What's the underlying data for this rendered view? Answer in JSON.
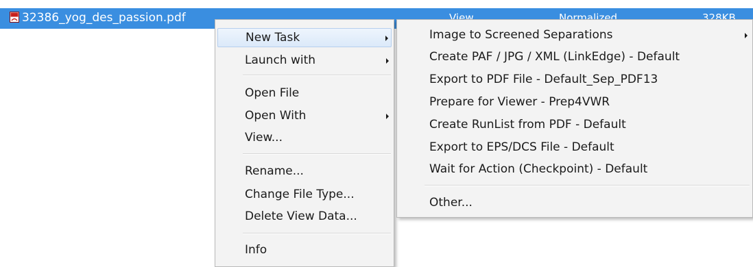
{
  "file_row": {
    "name": "32386_yog_des_passion.pdf",
    "view": "View",
    "status": "Normalized",
    "size": "328KB",
    "icon": "pdf-file-icon",
    "highlight_color": "#3a8ee0"
  },
  "context_menu": {
    "items": [
      {
        "label": "New Task"
      },
      {
        "label": "Launch with"
      },
      {
        "label": "Open File"
      },
      {
        "label": "Open With"
      },
      {
        "label": "View..."
      },
      {
        "label": "Rename..."
      },
      {
        "label": "Change File Type..."
      },
      {
        "label": "Delete View Data..."
      },
      {
        "label": "Info"
      }
    ]
  },
  "submenu": {
    "items": [
      {
        "label": "Image to Screened Separations"
      },
      {
        "label": "Create PAF / JPG / XML (LinkEdge) - Default"
      },
      {
        "label": "Export to PDF File - Default_Sep_PDF13"
      },
      {
        "label": "Prepare for Viewer - Prep4VWR"
      },
      {
        "label": "Create RunList from PDF - Default"
      },
      {
        "label": "Export to EPS/DCS File - Default"
      },
      {
        "label": "Wait for Action (Checkpoint) - Default"
      },
      {
        "label": "Other..."
      }
    ]
  }
}
